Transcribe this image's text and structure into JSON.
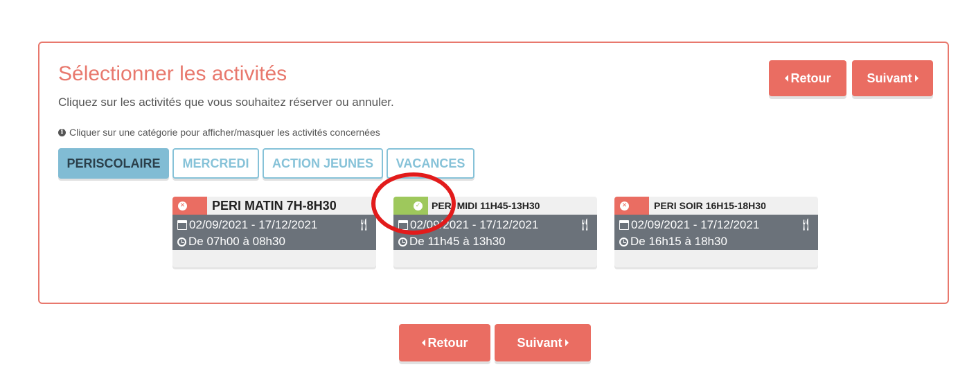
{
  "header": {
    "title": "Sélectionner les activités",
    "subtitle": "Cliquez sur les activités que vous souhaitez réserver ou annuler.",
    "info": "Cliquer sur une catégorie pour afficher/masquer les activités concernées"
  },
  "nav": {
    "back_label": "Retour",
    "next_label": "Suivant"
  },
  "tabs": [
    "PERISCOLAIRE",
    "MERCREDI",
    "ACTION JEUNES",
    "VACANCES"
  ],
  "activities": [
    {
      "title": "PERI MATIN 7H-8H30",
      "status": "not-selected",
      "dates": "02/09/2021 - 17/12/2021",
      "hours": "De 07h00 à 08h30"
    },
    {
      "title": "PERI MIDI 11H45-13H30",
      "status": "selected",
      "dates": "02/09/2021 - 17/12/2021",
      "hours": "De 11h45 à 13h30"
    },
    {
      "title": "PERI SOIR 16H15-18H30",
      "status": "not-selected",
      "dates": "02/09/2021 - 17/12/2021",
      "hours": "De 16h15 à 18h30"
    }
  ],
  "colors": {
    "accent": "#ea6d62",
    "tab_active": "#81bcd4",
    "tab_border": "#86c2d8",
    "selected": "#9ec85c",
    "card_body": "#6b727a",
    "annotation": "#e21b1b"
  },
  "icons": {
    "info": "info-circle-icon",
    "cancel": "times-circle-icon",
    "selected": "check-circle-icon",
    "date": "calendar-icon",
    "hours": "clock-icon",
    "meal": "cutlery-icon"
  }
}
